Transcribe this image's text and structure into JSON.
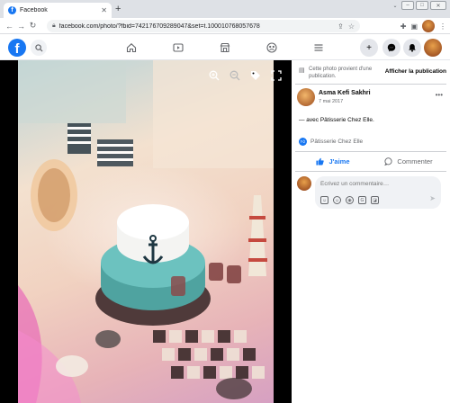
{
  "browser": {
    "tab_title": "Facebook",
    "tab_favicon": "f",
    "url": "facebook.com/photo/?fbid=742176709289047&set=t.100010768057678"
  },
  "fb": {
    "logo_letter": "f"
  },
  "notice": {
    "text": "Cette photo provient d'une publication.",
    "button": "Afficher la publication"
  },
  "post": {
    "author": "Asma Kefi Sakhri",
    "date": "7 mai 2017",
    "caption": "— avec Pâtisserie Chez Elle.",
    "reaction_name": "Pâtisserie Chez Elle"
  },
  "actions": {
    "like": "J'aime",
    "comment": "Commenter"
  },
  "composer": {
    "placeholder": "Écrivez un commentaire…"
  },
  "colors": {
    "brand": "#1877f2",
    "secondary_text": "#65676b",
    "viewer_bg": "#000000"
  }
}
